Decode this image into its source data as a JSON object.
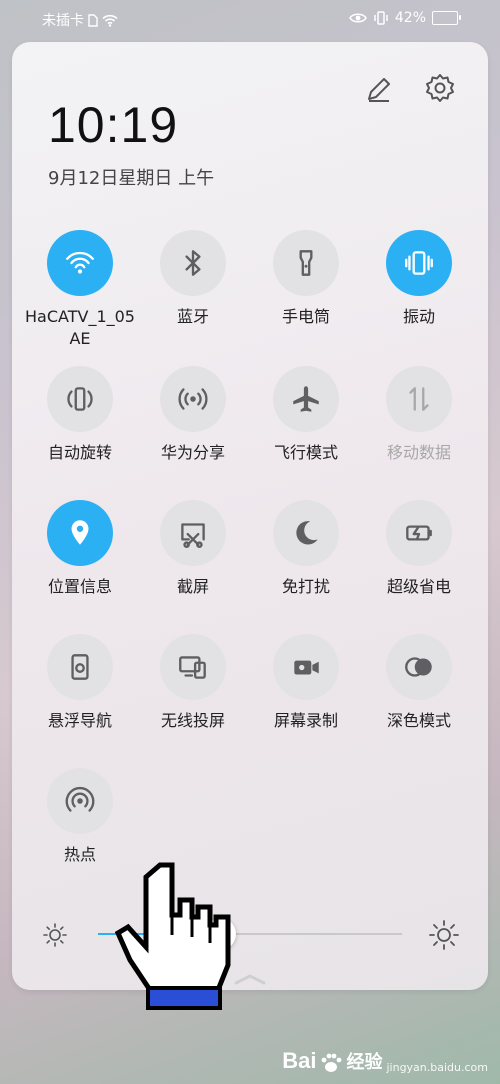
{
  "status_bar": {
    "carrier": "未插卡",
    "battery_percent": "42%",
    "battery_level": 0.42
  },
  "header": {
    "time": "10:19",
    "date": "9月12日星期日 上午"
  },
  "tiles": [
    {
      "id": "wifi",
      "label": "HaCATV_1_05AE",
      "active": true,
      "icon": "wifi-icon"
    },
    {
      "id": "bluetooth",
      "label": "蓝牙",
      "active": false,
      "icon": "bluetooth-icon"
    },
    {
      "id": "flashlight",
      "label": "手电筒",
      "active": false,
      "icon": "flashlight-icon"
    },
    {
      "id": "vibrate",
      "label": "振动",
      "active": true,
      "icon": "vibrate-icon"
    },
    {
      "id": "auto-rotate",
      "label": "自动旋转",
      "active": false,
      "icon": "auto-rotate-icon"
    },
    {
      "id": "huawei-share",
      "label": "华为分享",
      "active": false,
      "icon": "huawei-share-icon"
    },
    {
      "id": "airplane",
      "label": "飞行模式",
      "active": false,
      "icon": "airplane-icon"
    },
    {
      "id": "mobile-data",
      "label": "移动数据",
      "active": false,
      "disabled": true,
      "icon": "mobile-data-icon"
    },
    {
      "id": "location",
      "label": "位置信息",
      "active": true,
      "icon": "location-icon"
    },
    {
      "id": "screenshot",
      "label": "截屏",
      "active": false,
      "icon": "screenshot-icon"
    },
    {
      "id": "dnd",
      "label": "免打扰",
      "active": false,
      "icon": "moon-icon"
    },
    {
      "id": "power-saver",
      "label": "超级省电",
      "active": false,
      "icon": "battery-saver-icon"
    },
    {
      "id": "float-nav",
      "label": "悬浮导航",
      "active": false,
      "icon": "float-nav-icon"
    },
    {
      "id": "wireless-projection",
      "label": "无线投屏",
      "active": false,
      "icon": "projection-icon"
    },
    {
      "id": "screen-record",
      "label": "屏幕录制",
      "active": false,
      "icon": "screen-record-icon"
    },
    {
      "id": "dark-mode",
      "label": "深色模式",
      "active": false,
      "icon": "dark-mode-icon"
    },
    {
      "id": "hotspot",
      "label": "热点",
      "active": false,
      "icon": "hotspot-icon"
    }
  ],
  "brightness": {
    "level": 0.5
  },
  "colors": {
    "accent": "#2bb0f3",
    "tile_off": "#e2e2e4",
    "icon_off": "#5f5f63"
  },
  "watermark": {
    "brand": "Bai",
    "brand2": "经验",
    "sub": "jingyan.baidu.com"
  }
}
